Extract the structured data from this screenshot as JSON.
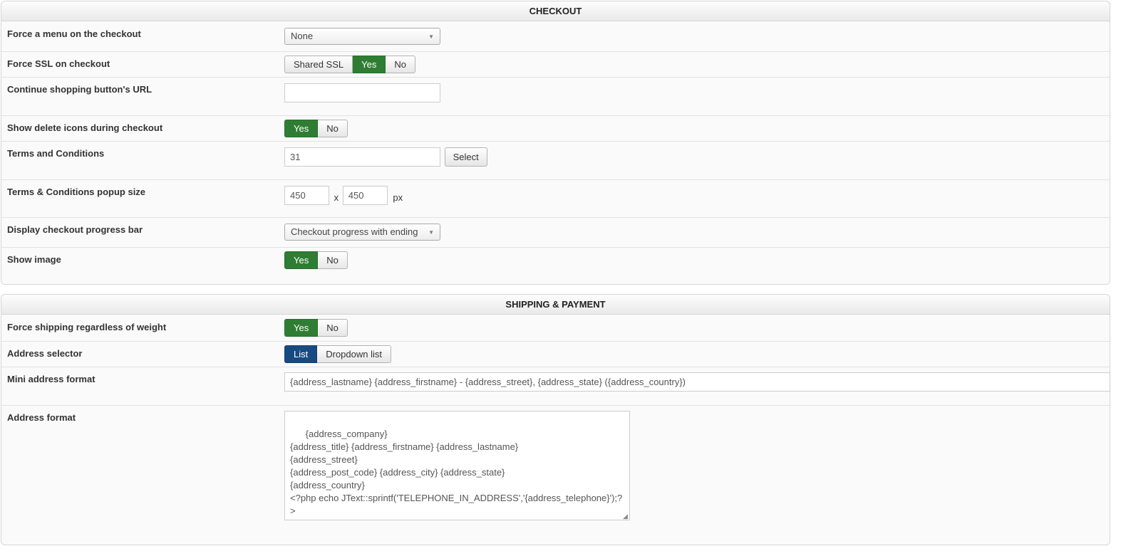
{
  "checkout": {
    "header": "CHECKOUT",
    "force_menu": {
      "label": "Force a menu on the checkout",
      "value": "None",
      "caret": "▼"
    },
    "force_ssl": {
      "label": "Force SSL on checkout",
      "options": [
        "Shared SSL",
        "Yes",
        "No"
      ],
      "selected": "Yes"
    },
    "continue_url": {
      "label": "Continue shopping button's URL",
      "value": ""
    },
    "delete_icons": {
      "label": "Show delete icons during checkout",
      "options": [
        "Yes",
        "No"
      ],
      "selected": "Yes"
    },
    "terms": {
      "label": "Terms and Conditions",
      "value": "31",
      "button": "Select"
    },
    "popup_size": {
      "label": "Terms & Conditions popup size",
      "width": "450",
      "height": "450",
      "separator": "x",
      "unit": "px"
    },
    "progress_bar": {
      "label": "Display checkout progress bar",
      "value": "Checkout progress with ending",
      "caret": "▼"
    },
    "show_image": {
      "label": "Show image",
      "options": [
        "Yes",
        "No"
      ],
      "selected": "Yes"
    }
  },
  "shipping": {
    "header": "SHIPPING & PAYMENT",
    "force_shipping": {
      "label": "Force shipping regardless of weight",
      "options": [
        "Yes",
        "No"
      ],
      "selected": "Yes"
    },
    "address_selector": {
      "label": "Address selector",
      "options": [
        "List",
        "Dropdown list"
      ],
      "selected": "List"
    },
    "mini_address": {
      "label": "Mini address format",
      "value": "{address_lastname} {address_firstname} - {address_street}, {address_state} ({address_country})"
    },
    "address_format": {
      "label": "Address format",
      "value": "{address_company}\n{address_title} {address_firstname} {address_lastname}\n{address_street}\n{address_post_code} {address_city} {address_state}\n{address_country}\n<?php echo JText::sprintf('TELEPHONE_IN_ADDRESS','{address_telephone}');?\n>",
      "grip": "◢"
    }
  },
  "colors": {
    "active_green": "#2f7d32",
    "active_blue": "#174a80"
  }
}
